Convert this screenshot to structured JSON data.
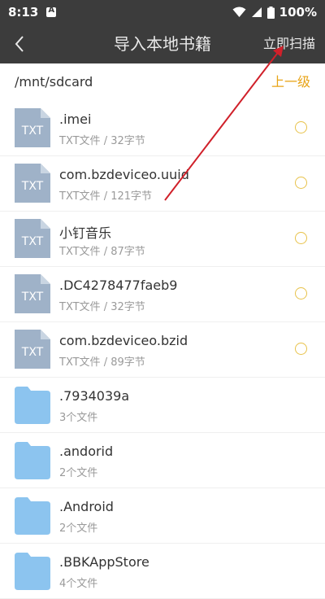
{
  "status_bar": {
    "time": "8:13",
    "battery": "100%",
    "icons": [
      "notification-a-icon",
      "wifi-icon",
      "signal-icon",
      "battery-icon"
    ]
  },
  "header": {
    "title": "导入本地书籍",
    "scan_label": "立即扫描",
    "back_icon": "back-arrow-icon"
  },
  "path_bar": {
    "path": "/mnt/sdcard",
    "up_label": "上一级"
  },
  "files": [
    {
      "name": ".imei",
      "meta": "TXT文件 / 32字节",
      "type": "txt",
      "icon_text": "TXT",
      "selectable": true
    },
    {
      "name": "com.bzdeviceo.uuid",
      "meta": "TXT文件 / 121字节",
      "type": "txt",
      "icon_text": "TXT",
      "selectable": true
    },
    {
      "name": "小钉音乐",
      "meta": "TXT文件 / 87字节",
      "type": "txt",
      "icon_text": "TXT",
      "selectable": true
    },
    {
      "name": ".DC4278477faeb9",
      "meta": "TXT文件 / 32字节",
      "type": "txt",
      "icon_text": "TXT",
      "selectable": true
    },
    {
      "name": "com.bzdeviceo.bzid",
      "meta": "TXT文件 / 89字节",
      "type": "txt",
      "icon_text": "TXT",
      "selectable": true
    },
    {
      "name": ".7934039a",
      "meta": "3个文件",
      "type": "folder",
      "selectable": false
    },
    {
      "name": ".andorid",
      "meta": "2个文件",
      "type": "folder",
      "selectable": false
    },
    {
      "name": ".Android",
      "meta": "2个文件",
      "type": "folder",
      "selectable": false
    },
    {
      "name": ".BBKAppStore",
      "meta": "4个文件",
      "type": "folder",
      "selectable": false
    }
  ],
  "colors": {
    "header_bg": "#3c3c3c",
    "accent": "#e8a417",
    "radio": "#e8c24a",
    "txt_icon": "#9fb2c8",
    "folder_icon": "#8cc4ef",
    "annotation_arrow": "#d0202a"
  },
  "annotation": {
    "type": "arrow",
    "points_to": "scan-button"
  }
}
